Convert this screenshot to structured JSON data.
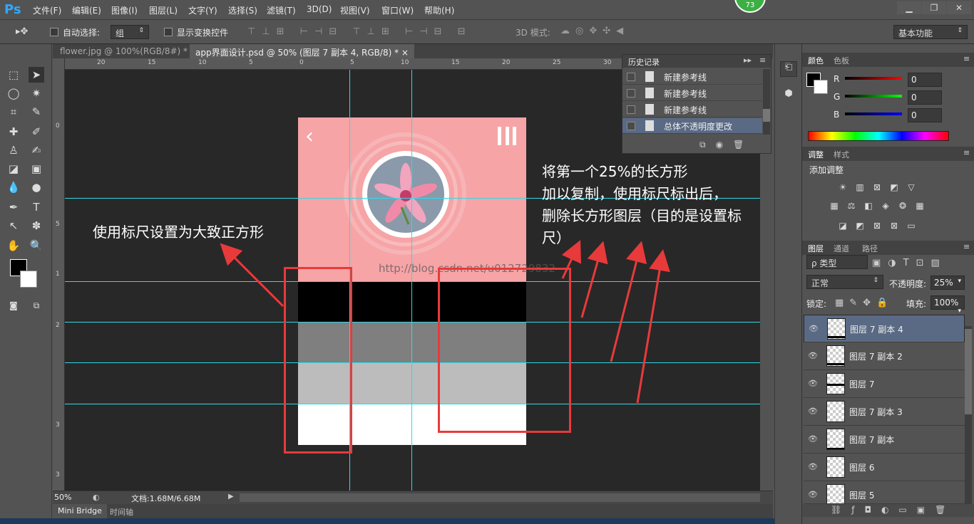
{
  "app": {
    "logo": "Ps",
    "badge": "73"
  },
  "menu": [
    "文件(F)",
    "编辑(E)",
    "图像(I)",
    "图层(L)",
    "文字(Y)",
    "选择(S)",
    "滤镜(T)",
    "3D(D)",
    "视图(V)",
    "窗口(W)",
    "帮助(H)"
  ],
  "options": {
    "auto_select_label": "自动选择:",
    "auto_select_value": "组",
    "show_transform_label": "显示变换控件",
    "mode_3d_label": "3D 模式:",
    "workspace": "基本功能"
  },
  "tabs": [
    {
      "label": "flower.jpg @ 100%(RGB/8#) *",
      "close": "×"
    },
    {
      "label": "app界面设计.psd @ 50% (图层 7 副本 4, RGB/8) *",
      "close": "×"
    }
  ],
  "ruler_h": [
    "20",
    "15",
    "10",
    "5",
    "0",
    "5",
    "10",
    "15",
    "20",
    "25",
    "30"
  ],
  "ruler_v": [
    "0",
    "5",
    "1",
    "1",
    "2",
    "2",
    "3",
    "3"
  ],
  "status": {
    "zoom": "50%",
    "doc": "文档:1.68M/6.68M"
  },
  "bottom_tabs": [
    "Mini Bridge",
    "时间轴"
  ],
  "history": {
    "title": "历史记录",
    "items": [
      "新建参考线",
      "新建参考线",
      "新建参考线",
      "总体不透明度更改"
    ]
  },
  "annotations": {
    "left": "使用标尺设置为大致正方形",
    "right_lines": [
      "将第一个25%的长方形",
      "加以复制，使用标尺标出后，",
      "删除长方形图层（目的是设置标尺）"
    ],
    "watermark": "http://blog.csdn.net/u012729832"
  },
  "color_panel": {
    "tabs": [
      "颜色",
      "色板"
    ],
    "channels": [
      {
        "label": "R",
        "value": "0"
      },
      {
        "label": "G",
        "value": "0"
      },
      {
        "label": "B",
        "value": "0"
      }
    ]
  },
  "adjust_panel": {
    "tabs": [
      "调整",
      "样式"
    ],
    "title": "添加调整"
  },
  "layers_panel": {
    "tabs": [
      "图层",
      "通道",
      "路径"
    ],
    "filter": "ρ 类型",
    "blend": "正常",
    "opacity_label": "不透明度:",
    "opacity": "25%",
    "lock_label": "锁定:",
    "fill_label": "填充:",
    "fill": "100%",
    "layers": [
      {
        "name": "图层 7 副本 4",
        "selected": true
      },
      {
        "name": "图层 7 副本 2",
        "selected": false
      },
      {
        "name": "图层 7",
        "selected": false
      },
      {
        "name": "图层 7 副本 3",
        "selected": false
      },
      {
        "name": "图层 7 副本",
        "selected": false
      },
      {
        "name": "图层 6",
        "selected": false
      },
      {
        "name": "图层 5",
        "selected": false
      }
    ]
  },
  "colors": {
    "accent": "#30a8ff",
    "guide": "#2fd9e8",
    "arrow": "#e83a3a",
    "pink": "#f6a4a6",
    "mid_gray": "#7f7f7f",
    "light_gray": "#bcbcbc"
  }
}
